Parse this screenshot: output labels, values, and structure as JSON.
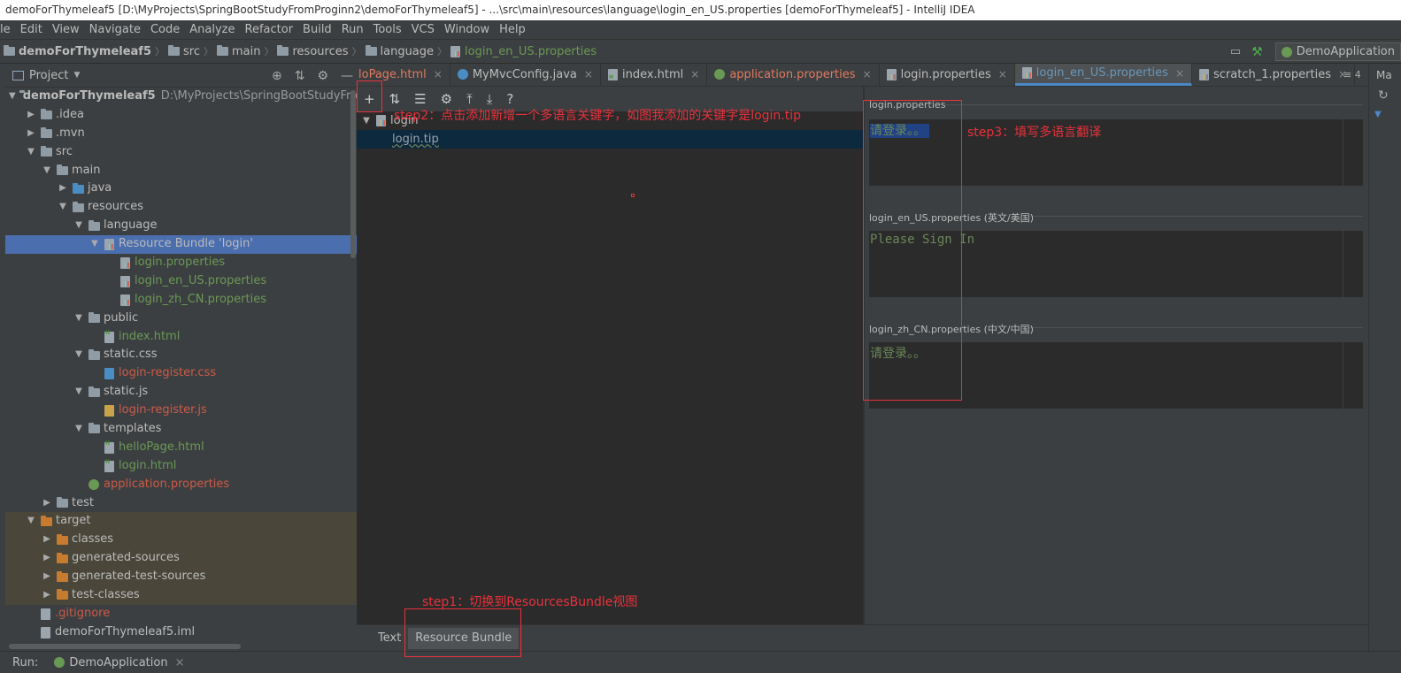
{
  "window": {
    "title": "demoForThymeleaf5 [D:\\MyProjects\\SpringBootStudyFromProginn2\\demoForThymeleaf5] - ...\\src\\main\\resources\\language\\login_en_US.properties [demoForThymeleaf5] - IntelliJ IDEA"
  },
  "menu": [
    "le",
    "Edit",
    "View",
    "Navigate",
    "Code",
    "Analyze",
    "Refactor",
    "Build",
    "Run",
    "Tools",
    "VCS",
    "Window",
    "Help"
  ],
  "breadcrumb": [
    "demoForThymeleaf5",
    "src",
    "main",
    "resources",
    "language",
    "login_en_US.properties"
  ],
  "run_config": {
    "label": "DemoApplication"
  },
  "project_panel": {
    "title": "Project",
    "tree": [
      {
        "label": "demoForThymeleaf5",
        "suffix": "D:\\MyProjects\\SpringBootStudyFromPro",
        "depth": 0,
        "arrow": "down",
        "icon": "module-icon",
        "style": "bold"
      },
      {
        "label": ".idea",
        "depth": 1,
        "arrow": "right",
        "icon": "folder-icon"
      },
      {
        "label": ".mvn",
        "depth": 1,
        "arrow": "right",
        "icon": "folder-icon"
      },
      {
        "label": "src",
        "depth": 1,
        "arrow": "down",
        "icon": "folder-icon"
      },
      {
        "label": "main",
        "depth": 2,
        "arrow": "down",
        "icon": "folder-icon"
      },
      {
        "label": "java",
        "depth": 3,
        "arrow": "right",
        "icon": "source-folder-icon"
      },
      {
        "label": "resources",
        "depth": 3,
        "arrow": "down",
        "icon": "resources-folder-icon"
      },
      {
        "label": "language",
        "depth": 4,
        "arrow": "down",
        "icon": "folder-icon"
      },
      {
        "label": "Resource Bundle 'login'",
        "depth": 5,
        "arrow": "down",
        "icon": "resource-bundle-icon",
        "selected": true
      },
      {
        "label": "login.properties",
        "depth": 6,
        "icon": "properties-file-icon",
        "color": "green"
      },
      {
        "label": "login_en_US.properties",
        "depth": 6,
        "icon": "properties-file-icon",
        "color": "green"
      },
      {
        "label": "login_zh_CN.properties",
        "depth": 6,
        "icon": "properties-file-icon",
        "color": "green"
      },
      {
        "label": "public",
        "depth": 4,
        "arrow": "down",
        "icon": "folder-icon"
      },
      {
        "label": "index.html",
        "depth": 5,
        "icon": "html-file-icon",
        "color": "green"
      },
      {
        "label": "static.css",
        "depth": 4,
        "arrow": "down",
        "icon": "folder-icon"
      },
      {
        "label": "login-register.css",
        "depth": 5,
        "icon": "css-file-icon",
        "color": "red"
      },
      {
        "label": "static.js",
        "depth": 4,
        "arrow": "down",
        "icon": "folder-icon"
      },
      {
        "label": "login-register.js",
        "depth": 5,
        "icon": "js-file-icon",
        "color": "red"
      },
      {
        "label": "templates",
        "depth": 4,
        "arrow": "down",
        "icon": "folder-icon"
      },
      {
        "label": "helloPage.html",
        "depth": 5,
        "icon": "html-file-icon",
        "color": "green"
      },
      {
        "label": "login.html",
        "depth": 5,
        "icon": "html-file-icon",
        "color": "green"
      },
      {
        "label": "application.properties",
        "depth": 4,
        "icon": "spring-properties-icon",
        "color": "red"
      },
      {
        "label": "test",
        "depth": 2,
        "arrow": "right",
        "icon": "folder-icon"
      },
      {
        "label": "target",
        "depth": 1,
        "arrow": "down",
        "icon": "excluded-folder-icon",
        "excluded": true
      },
      {
        "label": "classes",
        "depth": 2,
        "arrow": "right",
        "icon": "excluded-folder-icon",
        "excluded": true
      },
      {
        "label": "generated-sources",
        "depth": 2,
        "arrow": "right",
        "icon": "excluded-folder-icon",
        "excluded": true
      },
      {
        "label": "generated-test-sources",
        "depth": 2,
        "arrow": "right",
        "icon": "excluded-folder-icon",
        "excluded": true
      },
      {
        "label": "test-classes",
        "depth": 2,
        "arrow": "right",
        "icon": "excluded-folder-icon",
        "excluded": true
      },
      {
        "label": ".gitignore",
        "depth": 1,
        "icon": "text-file-icon",
        "color": "red"
      },
      {
        "label": "demoForThymeleaf5.iml",
        "depth": 1,
        "icon": "iml-file-icon"
      }
    ]
  },
  "editor_tabs": [
    {
      "label": "loPage.html",
      "icon": "html-file-icon",
      "color": "red"
    },
    {
      "label": "MyMvcConfig.java",
      "icon": "java-class-icon",
      "color": "default"
    },
    {
      "label": "index.html",
      "icon": "html-file-icon",
      "color": "default"
    },
    {
      "label": "application.properties",
      "icon": "spring-properties-icon",
      "color": "red"
    },
    {
      "label": "login.properties",
      "icon": "properties-file-icon",
      "color": "default"
    },
    {
      "label": "login_en_US.properties",
      "icon": "properties-file-icon",
      "color": "default",
      "active": true
    },
    {
      "label": "scratch_1.properties",
      "icon": "properties-file-icon",
      "color": "default"
    }
  ],
  "tab_overflow": "≡ 4",
  "rb_toolbar": [
    "+",
    "⇅",
    "☰",
    "⚙",
    "⤒",
    "⤓",
    "?"
  ],
  "rb_tree": {
    "group": "login",
    "key": "login.tip"
  },
  "values": [
    {
      "file": "login.properties",
      "value": "请登录。。",
      "highlighted": true
    },
    {
      "file": "login_en_US.properties (英文/美国)",
      "value": "Please Sign In"
    },
    {
      "file": "login_zh_CN.properties (中文/中国)",
      "value": "请登录。。"
    }
  ],
  "bottom_tabs": [
    {
      "label": "Text"
    },
    {
      "label": "Resource Bundle",
      "active": true
    }
  ],
  "runbar": {
    "label": "Run:",
    "config": "DemoApplication"
  },
  "annotations": {
    "step1": "step1：切换到ResourcesBundle视图",
    "step2": "step2：点击添加新增一个多语言关键字，如图我添加的关键字是login.tip",
    "step3": "step3：填写多语言翻译"
  },
  "colors": {
    "accent": "#4a88c7",
    "selection": "#4b6eaf",
    "annotation": "#e8323c",
    "green_file": "#6a9955",
    "red_file": "#cc5a48"
  }
}
